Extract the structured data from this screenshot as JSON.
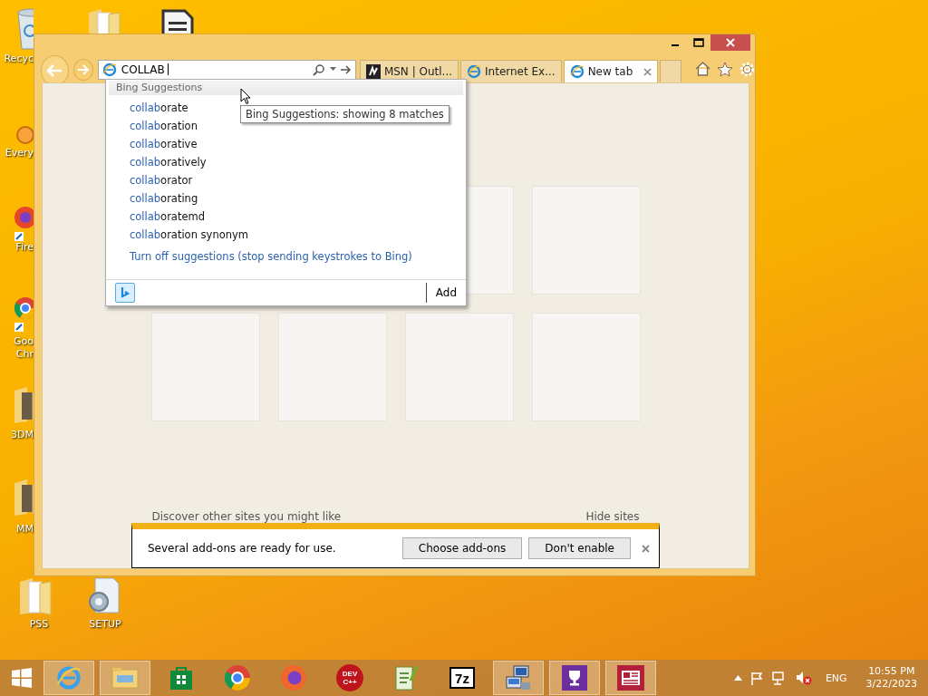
{
  "desktop_icons": [
    {
      "kind": "recycle-bin",
      "label": "Recyc"
    },
    {
      "kind": "folder"
    },
    {
      "kind": "document"
    },
    {
      "kind": "everything",
      "label": "Every"
    },
    {
      "kind": "firefox",
      "label": "Fire"
    },
    {
      "kind": "chrome",
      "label": "Goo Chr"
    },
    {
      "kind": "photo-folder",
      "label": "3DM"
    },
    {
      "kind": "photo-folder",
      "label": "MM"
    },
    {
      "kind": "folder",
      "label": "PSS"
    },
    {
      "kind": "setup",
      "label": "SETUP"
    }
  ],
  "browser": {
    "address": {
      "value": "COLLAB"
    },
    "tabs": [
      {
        "title": "MSN | Outl...",
        "kind": "msn",
        "selected": false
      },
      {
        "title": "Internet Ex...",
        "kind": "ie",
        "selected": false
      },
      {
        "title": "New tab",
        "kind": "ie",
        "selected": true
      }
    ],
    "new_tab_page": {
      "discover": "Discover other sites you might like",
      "hide": "Hide sites"
    },
    "notification": {
      "message": "Several add-ons are ready for use.",
      "buttons": [
        "Choose add-ons",
        "Don't enable"
      ]
    }
  },
  "suggestions": {
    "header": "Bing Suggestions",
    "items": [
      {
        "match": "collab",
        "rest": "orate"
      },
      {
        "match": "collab",
        "rest": "oration"
      },
      {
        "match": "collab",
        "rest": "orative"
      },
      {
        "match": "collab",
        "rest": "oratively"
      },
      {
        "match": "collab",
        "rest": "orator"
      },
      {
        "match": "collab",
        "rest": "orating"
      },
      {
        "match": "collab",
        "rest": "oratemd"
      },
      {
        "match": "collab",
        "rest": "oration synonym"
      }
    ],
    "turn_off": "Turn off suggestions (stop sending keystrokes to Bing)",
    "add": "Add"
  },
  "tooltip": "Bing Suggestions: showing 8 matches",
  "taskbar": {
    "items": [
      {
        "kind": "ie",
        "running": true
      },
      {
        "kind": "explorer",
        "running": true
      },
      {
        "kind": "store",
        "running": false
      },
      {
        "kind": "chrome",
        "running": false
      },
      {
        "kind": "firefox",
        "running": false
      },
      {
        "kind": "devcpp",
        "text": "DEV C++",
        "running": false
      },
      {
        "kind": "notepadpp",
        "running": false
      },
      {
        "kind": "archiver",
        "text": "7z",
        "running": false
      },
      {
        "kind": "computer",
        "running": true
      },
      {
        "kind": "trophy",
        "running": true
      },
      {
        "kind": "news",
        "running": true
      }
    ],
    "tray": {
      "language": "ENG",
      "time": "10:55 PM",
      "date": "3/22/2023"
    }
  }
}
